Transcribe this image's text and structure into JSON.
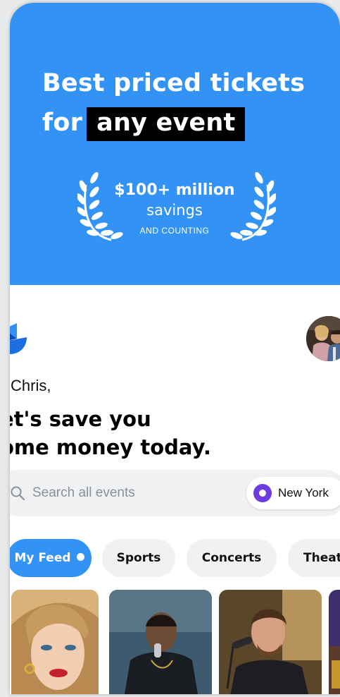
{
  "hero": {
    "title_line1": "Best priced tickets",
    "title_line2_prefix": "for",
    "title_highlight": "any event",
    "award_amount": "$100+ million",
    "award_label": "savings",
    "award_sub": "AND COUNTING",
    "background_color": "#3293f5"
  },
  "header": {
    "logo_icon": "brand-logo-icon",
    "avatar_icon": "user-avatar"
  },
  "greeting": {
    "hello": "i Chris,",
    "tagline_line1": "et's save you",
    "tagline_line2": "ome money today."
  },
  "search": {
    "placeholder": "Search all events",
    "location": "New York"
  },
  "tabs": [
    {
      "label": "My Feed",
      "active": true
    },
    {
      "label": "Sports",
      "active": false
    },
    {
      "label": "Concerts",
      "active": false
    },
    {
      "label": "Theat",
      "active": false
    }
  ],
  "cards": [
    "artist-photo-1",
    "artist-photo-2",
    "artist-photo-3",
    "artist-photo-4"
  ],
  "colors": {
    "accent": "#3293f5",
    "location_pin": "#6d3be0"
  }
}
